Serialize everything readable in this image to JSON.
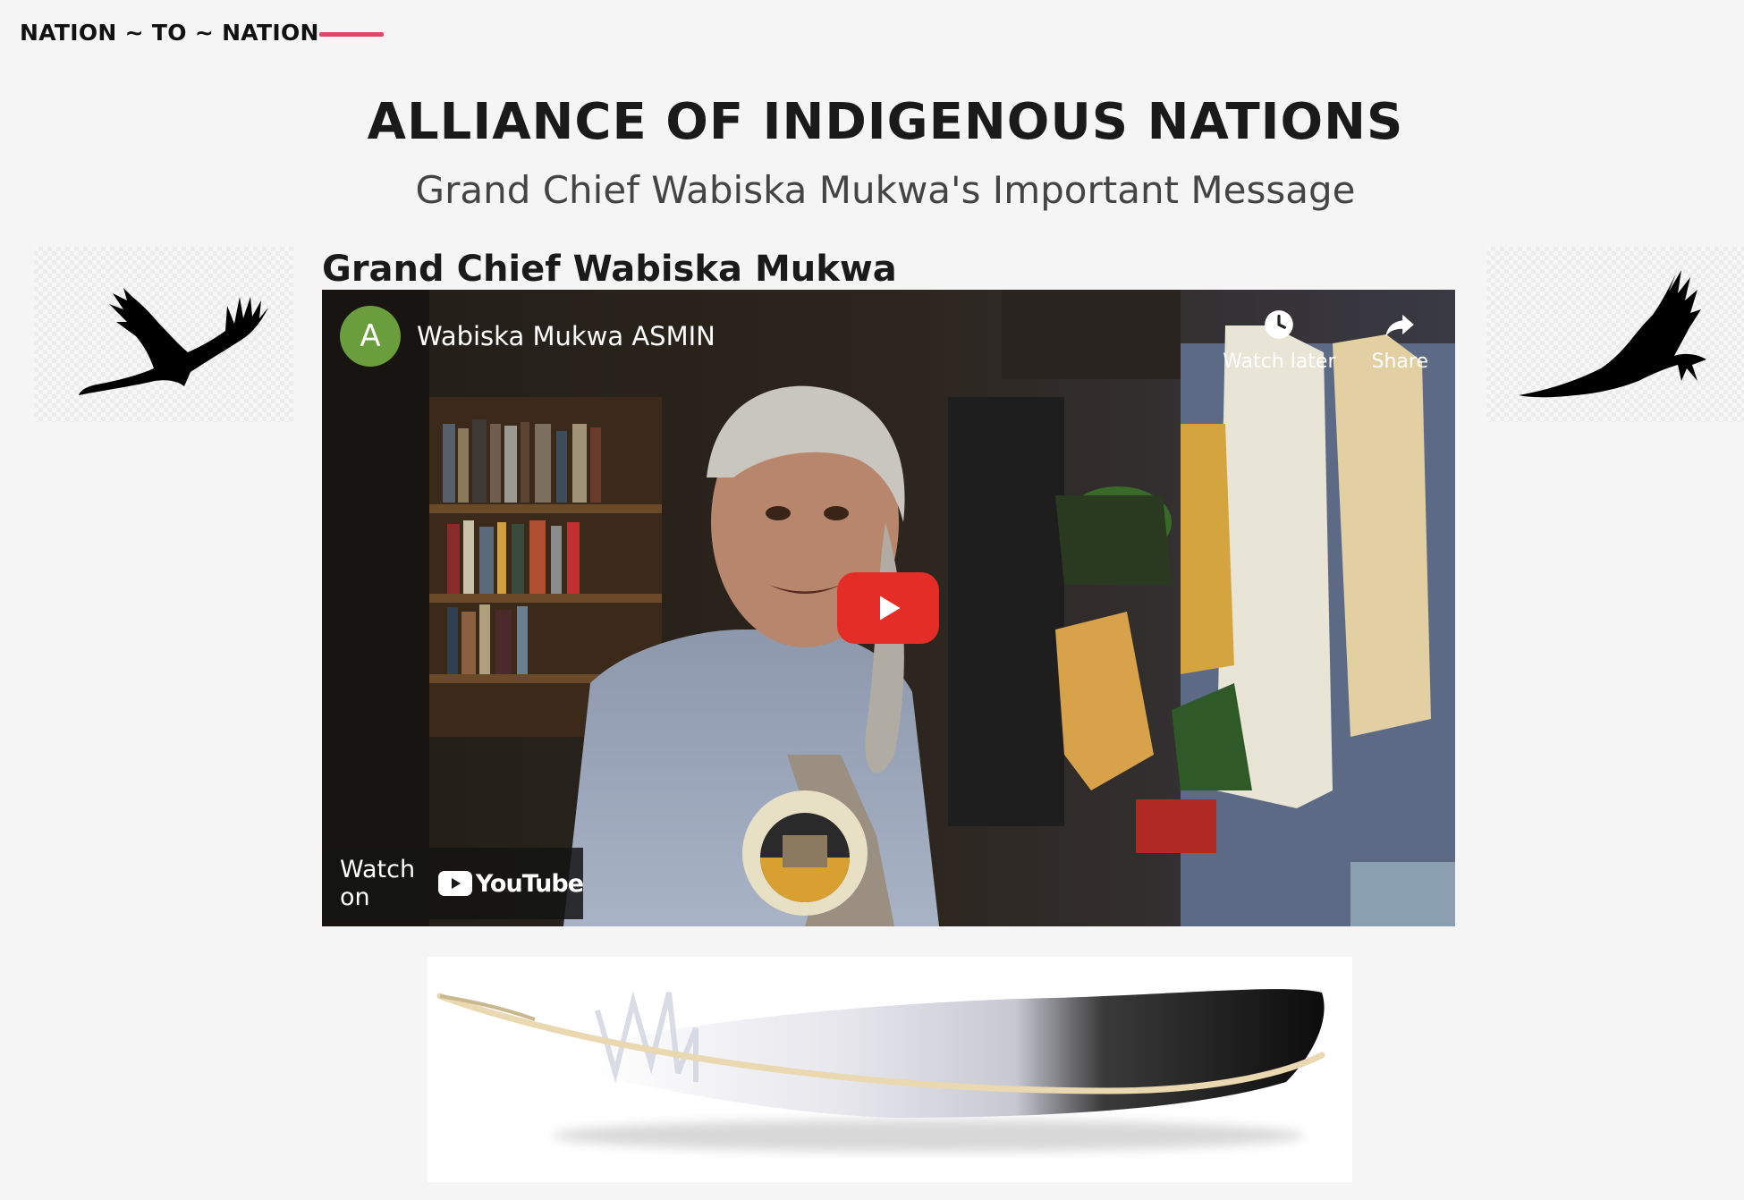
{
  "header": {
    "brand": "NATION ~ TO ~ NATION",
    "accent_color": "#e0466a"
  },
  "page": {
    "title": "ALLIANCE OF INDIGENOUS NATIONS",
    "subtitle": "Grand Chief Wabiska Mukwa's Important Message",
    "section_heading": "Grand Chief Wabiska Mukwa"
  },
  "video": {
    "channel_initial": "A",
    "channel_name": "Wabiska Mukwa ASMIN",
    "watch_later_label": "Watch later",
    "share_label": "Share",
    "watch_on_label": "Watch on",
    "youtube_label": "YouTube",
    "play_color": "#e52d27"
  },
  "icons": [
    "eagle-silhouette-icon",
    "clock-icon",
    "share-arrow-icon",
    "play-icon",
    "youtube-logo-icon",
    "feather-image"
  ]
}
